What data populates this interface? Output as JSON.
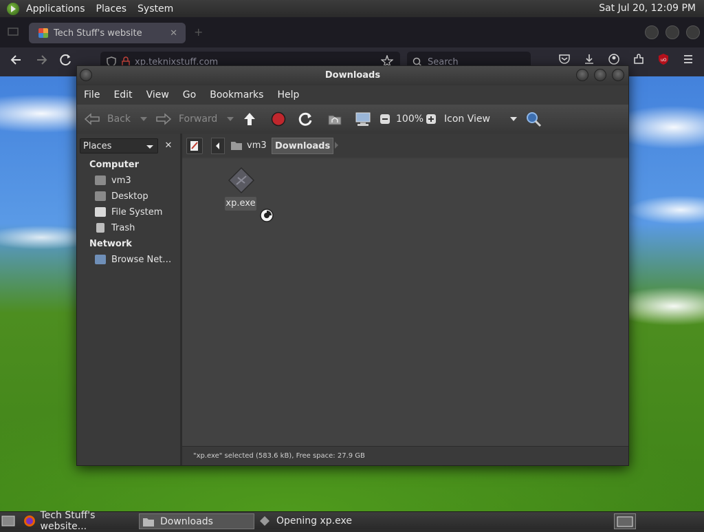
{
  "top_panel": {
    "menus": [
      "Applications",
      "Places",
      "System"
    ],
    "clock": "Sat Jul 20, 12:09 PM"
  },
  "browser": {
    "tab_title": "Tech Stuff's website",
    "tab_close": "✕",
    "url": "xp.teknixstuff.com",
    "search_placeholder": "Search"
  },
  "file_manager": {
    "title": "Downloads",
    "menu": [
      "File",
      "Edit",
      "View",
      "Go",
      "Bookmarks",
      "Help"
    ],
    "toolbar": {
      "back": "Back",
      "forward": "Forward",
      "zoom": "100%",
      "view_mode": "Icon View"
    },
    "sidebar": {
      "selector": "Places",
      "close": "✕",
      "sections": [
        {
          "heading": "Computer",
          "items": [
            "vm3",
            "Desktop",
            "File System",
            "Trash"
          ]
        },
        {
          "heading": "Network",
          "items": [
            "Browse Net…"
          ]
        }
      ]
    },
    "path": [
      "vm3",
      "Downloads"
    ],
    "files": [
      {
        "name": "xp.exe"
      }
    ],
    "status": "\"xp.exe\" selected (583.6 kB), Free space: 27.9 GB"
  },
  "taskbar": {
    "items": [
      "Tech Stuff's website...",
      "Downloads",
      "Opening xp.exe"
    ]
  },
  "colors": {
    "window_bg": "#3c3c3c",
    "content_bg": "#424242",
    "stop_red": "#c0272d",
    "panel_bg": "#2d2d2d"
  }
}
